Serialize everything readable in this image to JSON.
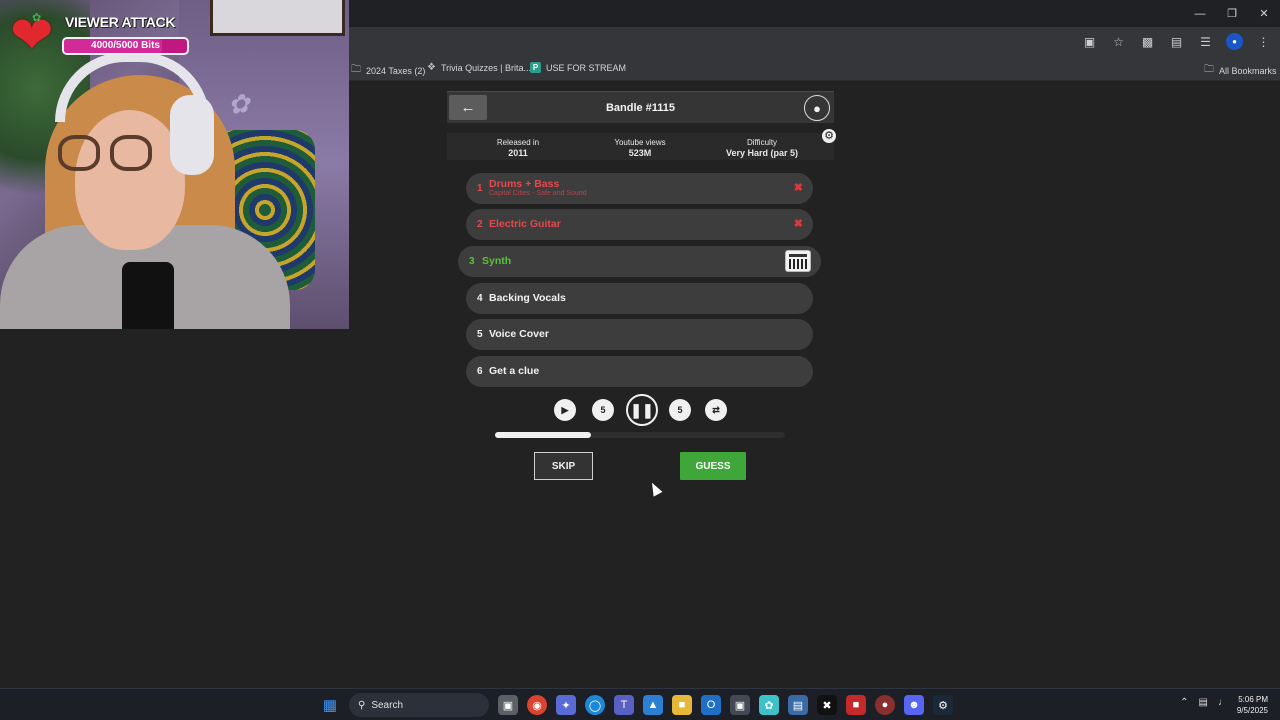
{
  "overlay": {
    "title": "VIEWER ATTACK",
    "bits_text": "4000/5000 Bits",
    "bits_fraction": 0.8
  },
  "bookmarks": [
    {
      "label": "2024 Taxes (2)",
      "icon": "folder-icon"
    },
    {
      "label": "Trivia Quizzes | Brita...",
      "icon": "trivia-icon"
    },
    {
      "label": "USE FOR STREAM",
      "icon": "p-icon",
      "badge": "P"
    },
    {
      "label": "All Bookmarks",
      "icon": "folder-icon"
    }
  ],
  "game": {
    "title": "Bandle #1115",
    "info": [
      {
        "label": "Released in",
        "value": "2011"
      },
      {
        "label": "Youtube views",
        "value": "523M"
      },
      {
        "label": "Difficulty",
        "value": "Very Hard (par 5)"
      }
    ],
    "tracks": [
      {
        "num": "1",
        "name": "Drums + Bass",
        "sub": "Capital Cities - Safe and Sound",
        "state": "wrong"
      },
      {
        "num": "2",
        "name": "Electric Guitar",
        "state": "wrong"
      },
      {
        "num": "3",
        "name": "Synth",
        "state": "active"
      },
      {
        "num": "4",
        "name": "Backing Vocals",
        "state": "locked"
      },
      {
        "num": "5",
        "name": "Voice Cover",
        "state": "locked"
      },
      {
        "num": "6",
        "name": "Get a clue",
        "state": "locked"
      }
    ],
    "controls": {
      "rewind_seconds": "5",
      "forward_seconds": "5"
    },
    "progress_fraction": 0.33,
    "skip_label": "SKIP",
    "guess_label": "GUESS"
  },
  "taskbar": {
    "search_label": "Search",
    "time": "5:06 PM",
    "date": "9/5/2025"
  },
  "colors": {
    "wrong": "#e8474c",
    "active": "#5bc236",
    "guess": "#3fa73a"
  }
}
